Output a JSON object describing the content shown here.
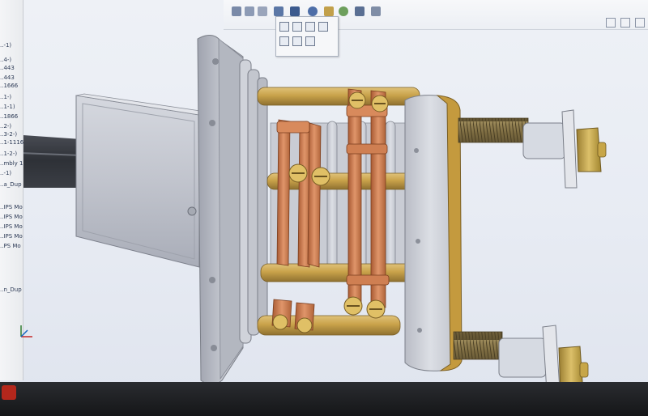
{
  "feature_tree": {
    "items": [
      {
        "label": "..-1)"
      },
      {
        "label": "..4-)"
      },
      {
        "label": "..443"
      },
      {
        "label": "..443"
      },
      {
        "label": "..1666"
      },
      {
        "label": "..1-)"
      },
      {
        "label": "..1-1)"
      },
      {
        "label": "..1866"
      },
      {
        "label": "..2-)"
      },
      {
        "label": "..3-2-)"
      },
      {
        "label": "..1-1116"
      },
      {
        "label": "..1-2-)"
      },
      {
        "label": "..mbly 1"
      },
      {
        "label": "..-1)"
      },
      {
        "label": "..a_Dup"
      },
      {
        "label": "..IPS Mo"
      },
      {
        "label": "..IPS Mo"
      },
      {
        "label": "..IPS Mo"
      },
      {
        "label": "..IPS Mo"
      },
      {
        "label": "..PS Mo"
      },
      {
        "label": "..n_Dup"
      }
    ]
  },
  "colors": {
    "viewport_bg": "#e9edf4",
    "brass": "#c9a24a",
    "copper": "#c8784a",
    "steel": "#c6cad3",
    "body": "#b9bdc8"
  }
}
